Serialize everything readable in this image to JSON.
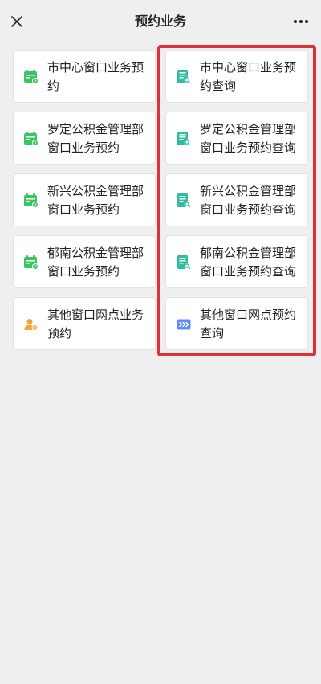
{
  "header": {
    "title": "预约业务",
    "close_icon": "close-icon",
    "more_icon": "more-dots-icon"
  },
  "left_column": [
    {
      "label": "市中心窗口业务预约",
      "icon": "calendar-icon",
      "icon_color": "#3cc464"
    },
    {
      "label": "罗定公积金管理部窗口业务预约",
      "icon": "calendar-icon",
      "icon_color": "#3cc464"
    },
    {
      "label": "新兴公积金管理部窗口业务预约",
      "icon": "calendar-icon",
      "icon_color": "#3cc464"
    },
    {
      "label": "郁南公积金管理部窗口业务预约",
      "icon": "calendar-icon",
      "icon_color": "#3cc464"
    },
    {
      "label": "其他窗口网点业务预约",
      "icon": "appointment-icon",
      "icon_color": "#f2a33a"
    }
  ],
  "right_column": [
    {
      "label": "市中心窗口业务预约查询",
      "icon": "document-search-icon",
      "icon_color": "#2dbd9f"
    },
    {
      "label": "罗定公积金管理部窗口业务预约查询",
      "icon": "document-search-icon",
      "icon_color": "#2dbd9f"
    },
    {
      "label": "新兴公积金管理部窗口业务预约查询",
      "icon": "document-search-icon",
      "icon_color": "#2dbd9f"
    },
    {
      "label": "郁南公积金管理部窗口业务预约查询",
      "icon": "document-search-icon",
      "icon_color": "#2dbd9f"
    },
    {
      "label": "其他窗口网点预约查询",
      "icon": "card-forward-icon",
      "icon_color": "#5b8df2"
    }
  ],
  "colors": {
    "background": "#efefef",
    "card": "#ffffff",
    "highlight_border": "#e0303a"
  }
}
